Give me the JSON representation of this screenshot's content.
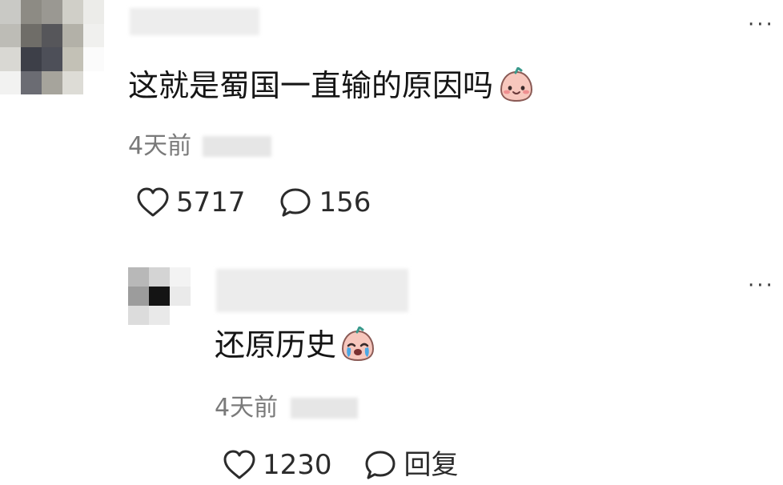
{
  "comments": [
    {
      "text": "这就是蜀国一直输的原因吗",
      "emoji": "blushing-face-emoji",
      "time": "4天前",
      "likes": "5717",
      "replies_count": "156"
    },
    {
      "text": "还原历史",
      "emoji": "crying-face-emoji",
      "time": "4天前",
      "likes": "1230",
      "reply_label": "回复"
    }
  ],
  "more_glyph": "···",
  "colors": {
    "text": "#151515",
    "meta": "#7a7a7a",
    "icon": "#2b2b2b",
    "blur": "#e6e6e6"
  }
}
